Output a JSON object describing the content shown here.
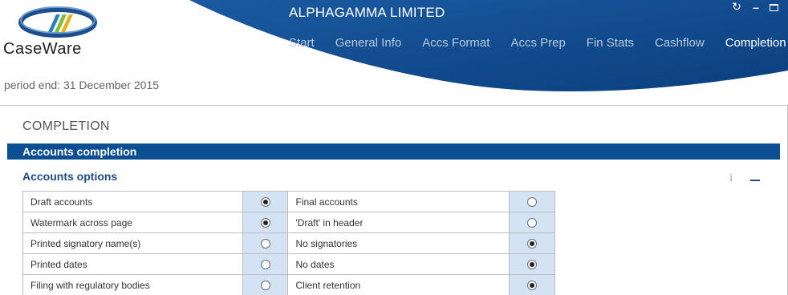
{
  "app": {
    "logo_text": "CaseWare",
    "company_name": "ALPHAGAMMA LIMITED",
    "brand_color": "#0b4f92"
  },
  "nav": {
    "items": [
      {
        "label": "Start",
        "active": false
      },
      {
        "label": "General Info",
        "active": false
      },
      {
        "label": "Accs Format",
        "active": false
      },
      {
        "label": "Accs Prep",
        "active": false
      },
      {
        "label": "Fin Stats",
        "active": false
      },
      {
        "label": "Cashflow",
        "active": false
      },
      {
        "label": "Completion",
        "active": true
      }
    ]
  },
  "window_controls": {
    "refresh_icon": "refresh-icon",
    "minimize_icon": "minimize-icon",
    "maximize_icon": "maximize-icon"
  },
  "period": "period end: 31 December 2015",
  "main": {
    "section_title": "COMPLETION",
    "bar_title": "Accounts completion",
    "subhead": "Accounts options",
    "info_symbol": "i"
  },
  "options": [
    {
      "left_label": "Draft accounts",
      "left_selected": true,
      "right_label": "Final accounts",
      "right_selected": false
    },
    {
      "left_label": "Watermark across page",
      "left_selected": true,
      "right_label": "'Draft' in header",
      "right_selected": false
    },
    {
      "left_label": "Printed signatory name(s)",
      "left_selected": false,
      "right_label": "No signatories",
      "right_selected": true
    },
    {
      "left_label": "Printed dates",
      "left_selected": false,
      "right_label": "No dates",
      "right_selected": true
    },
    {
      "left_label": "Filing with regulatory bodies",
      "left_selected": false,
      "right_label": "Client retention",
      "right_selected": true
    }
  ]
}
